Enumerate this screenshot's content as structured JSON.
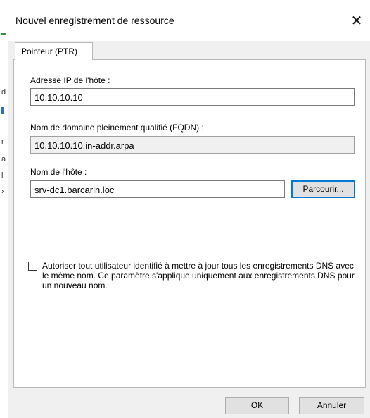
{
  "window": {
    "title": "Nouvel enregistrement de ressource",
    "close_glyph": "✕"
  },
  "tab": {
    "label": "Pointeur (PTR)"
  },
  "form": {
    "ip_label": "Adresse IP de l'hôte :",
    "ip_value": "10.10.10.10",
    "fqdn_label": "Nom de domaine pleinement qualifié (FQDN) :",
    "fqdn_value": "10.10.10.10.in-addr.arpa",
    "host_label": "Nom de l'hôte :",
    "host_value": "srv-dc1.barcarin.loc",
    "browse_label": "Parcourir...",
    "checkbox_checked": false,
    "checkbox_text": "Autoriser tout utilisateur identifié à mettre à jour tous les enregistrements DNS avec le même nom. Ce paramètre s'applique uniquement aux enregistrements DNS pour un nouveau nom."
  },
  "footer": {
    "ok_label": "OK",
    "cancel_label": "Annuler"
  },
  "colors": {
    "focus_border": "#0078d7",
    "dialog_bg": "#f0f0f0"
  }
}
